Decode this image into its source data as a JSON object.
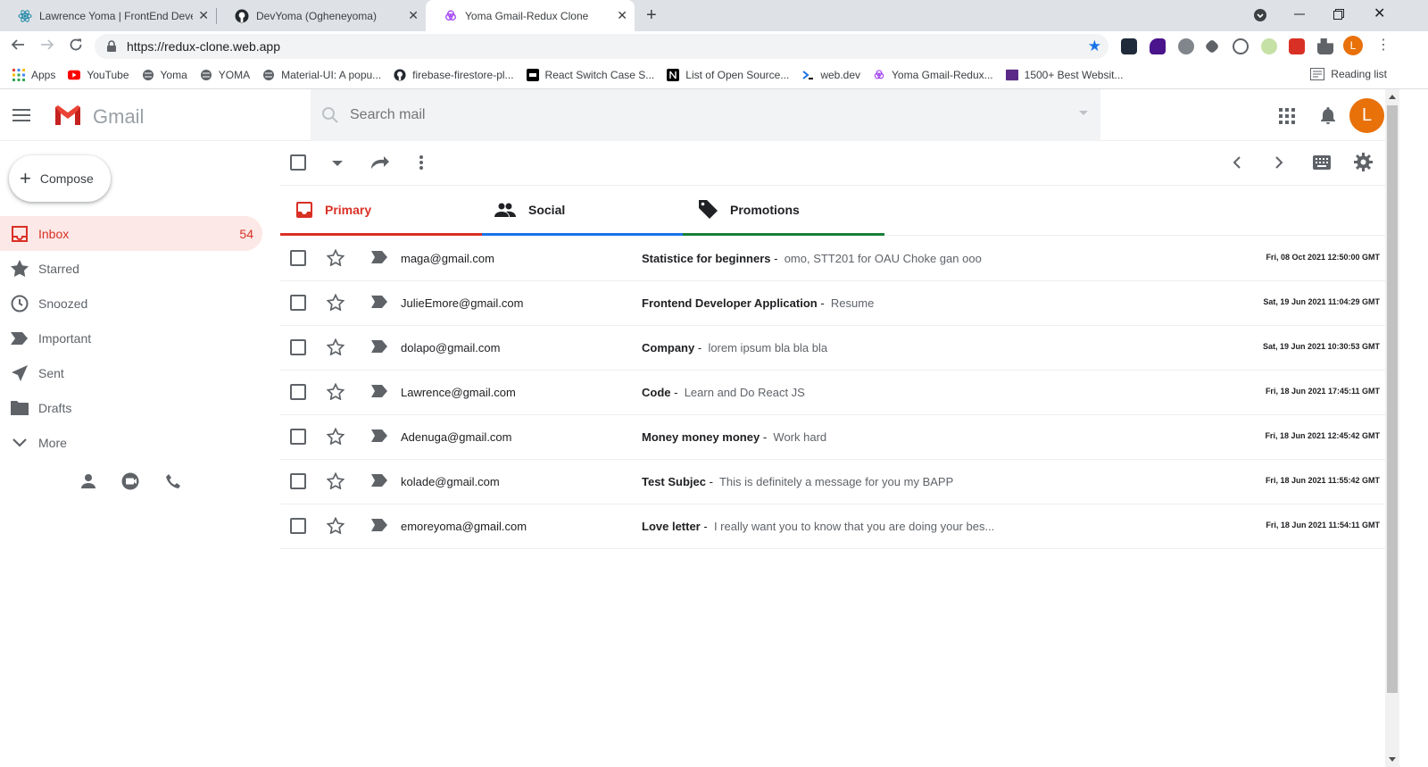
{
  "browser": {
    "tabs": [
      {
        "title": "Lawrence Yoma | FrontEnd Devel",
        "icon": "react-icon"
      },
      {
        "title": "DevYoma (Ogheneyoma)",
        "icon": "github-icon"
      },
      {
        "title": "Yoma Gmail-Redux Clone",
        "icon": "firebase-icon"
      }
    ],
    "url": "https://redux-clone.web.app",
    "profile_initial": "L",
    "bookmarks": [
      {
        "label": "Apps",
        "icon": "apps-grid-icon"
      },
      {
        "label": "YouTube",
        "icon": "youtube-icon"
      },
      {
        "label": "Yoma",
        "icon": "globe-icon"
      },
      {
        "label": "YOMA",
        "icon": "globe-icon"
      },
      {
        "label": "Material-UI: A popu...",
        "icon": "globe-icon"
      },
      {
        "label": "firebase-firestore-pl...",
        "icon": "github-icon"
      },
      {
        "label": "React Switch Case S...",
        "icon": "dev-icon"
      },
      {
        "label": "List of Open Source...",
        "icon": "notion-icon"
      },
      {
        "label": "web.dev",
        "icon": "webdev-icon"
      },
      {
        "label": "Yoma Gmail-Redux...",
        "icon": "firebase-icon"
      },
      {
        "label": "1500+ Best Websit...",
        "icon": "colorlib-icon"
      }
    ],
    "reading_list": "Reading list"
  },
  "gmail": {
    "brand": "Gmail",
    "search_placeholder": "Search mail",
    "avatar_initial": "L",
    "compose_label": "Compose",
    "sidebar": [
      {
        "label": "Inbox",
        "count": "54",
        "icon": "inbox-icon",
        "active": true
      },
      {
        "label": "Starred",
        "count": "",
        "icon": "star-icon"
      },
      {
        "label": "Snoozed",
        "count": "",
        "icon": "clock-icon"
      },
      {
        "label": "Important",
        "count": "",
        "icon": "label-important-icon"
      },
      {
        "label": "Sent",
        "count": "",
        "icon": "send-icon"
      },
      {
        "label": "Drafts",
        "count": "",
        "icon": "drafts-icon"
      },
      {
        "label": "More",
        "count": "",
        "icon": "chevron-down-icon"
      }
    ],
    "tabs": [
      {
        "label": "Primary",
        "color": "#d93025"
      },
      {
        "label": "Social",
        "color": "#1a73e8"
      },
      {
        "label": "Promotions",
        "color": "#188038"
      }
    ],
    "emails": [
      {
        "from": "maga@gmail.com",
        "subject": "Statistice for beginners",
        "snippet": "omo, STT201 for OAU Choke gan ooo",
        "date": "Fri, 08 Oct 2021 12:50:00 GMT"
      },
      {
        "from": "JulieEmore@gmail.com",
        "subject": "Frontend Developer Application",
        "snippet": "Resume",
        "date": "Sat, 19 Jun 2021 11:04:29 GMT"
      },
      {
        "from": "dolapo@gmail.com",
        "subject": "Company",
        "snippet": "lorem ipsum bla bla bla",
        "date": "Sat, 19 Jun 2021 10:30:53 GMT"
      },
      {
        "from": "Lawrence@gmail.com",
        "subject": "Code",
        "snippet": "Learn and Do React JS",
        "date": "Fri, 18 Jun 2021 17:45:11 GMT"
      },
      {
        "from": "Adenuga@gmail.com",
        "subject": "Money money money",
        "snippet": "Work hard",
        "date": "Fri, 18 Jun 2021 12:45:42 GMT"
      },
      {
        "from": "kolade@gmail.com",
        "subject": "Test Subjec",
        "snippet": "This is definitely a message for you my BAPP",
        "date": "Fri, 18 Jun 2021 11:55:42 GMT"
      },
      {
        "from": "emoreyoma@gmail.com",
        "subject": "Love letter",
        "snippet": "I really want you to know that you are doing your bes...",
        "date": "Fri, 18 Jun 2021 11:54:11 GMT"
      }
    ],
    "separator": "-",
    "colors": {
      "primary_red": "#d93025",
      "accent_orange": "#e8710a"
    }
  }
}
